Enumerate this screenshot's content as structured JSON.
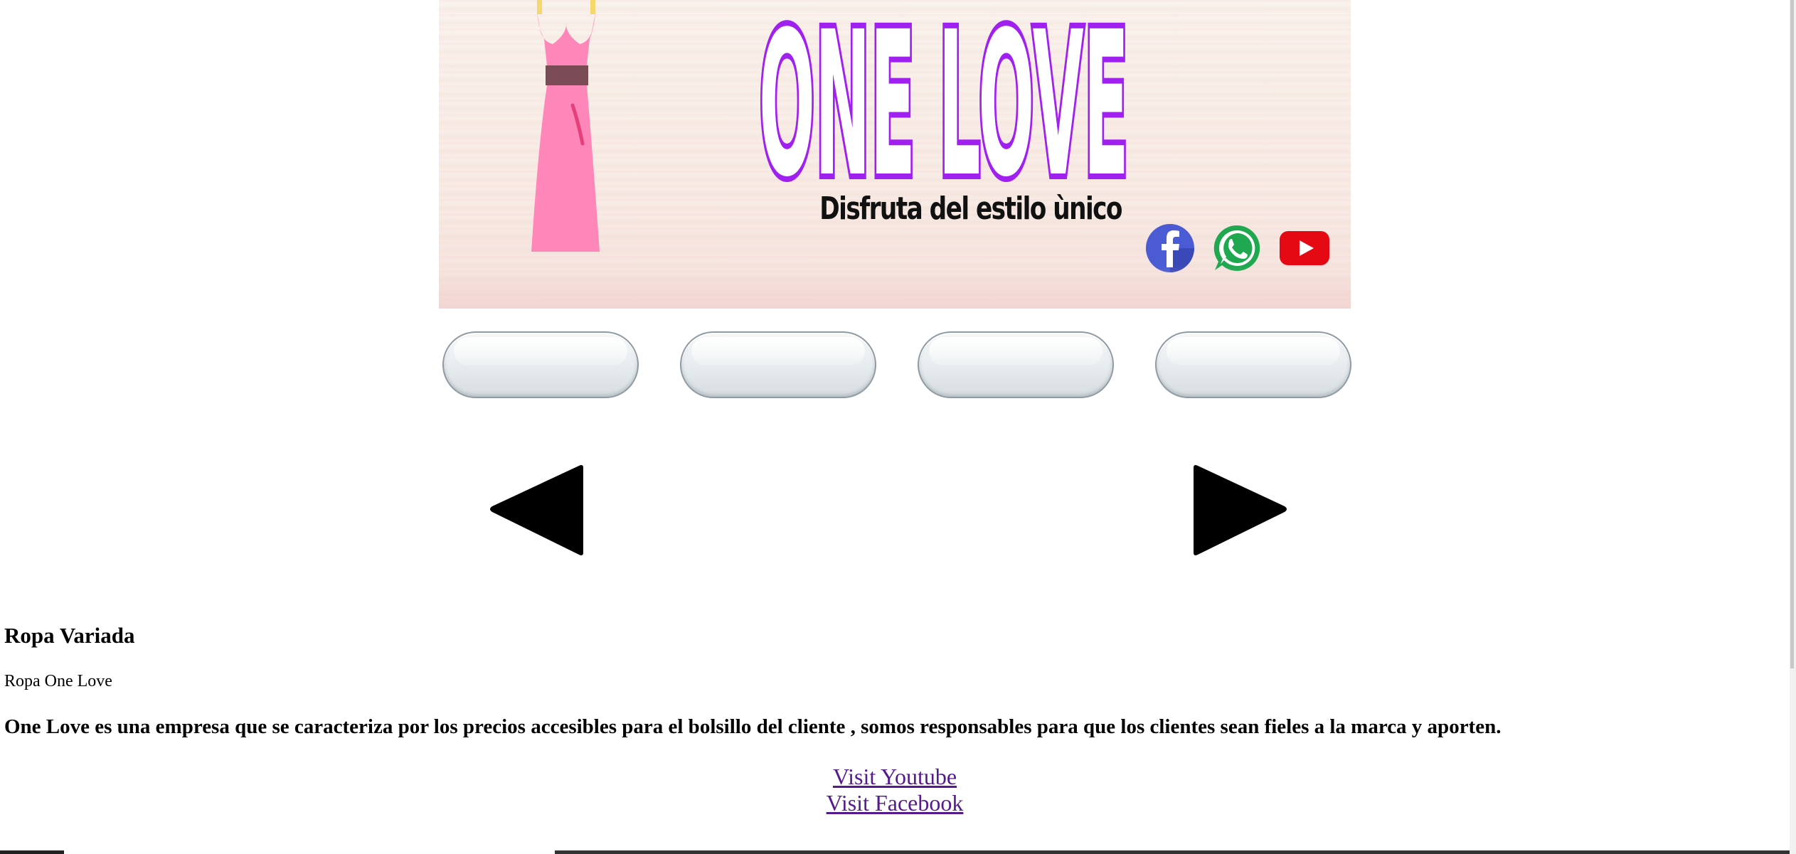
{
  "banner": {
    "logo_text": "ONE LOVE",
    "tagline": "Disfruta del estilo ùnico",
    "social": [
      {
        "icon": "facebook-icon",
        "color": "#4a5bd4"
      },
      {
        "icon": "whatsapp-icon",
        "color": "#1fa84f"
      },
      {
        "icon": "youtube-icon",
        "color": "#e50914"
      }
    ],
    "colors": {
      "logo_fill": "#ffffff",
      "logo_outline": "#a020f0",
      "dress": "#ff86b8",
      "dress_belt": "#7a4a55",
      "strap": "#f5d76e"
    }
  },
  "nav": {
    "buttons": [
      "",
      "",
      "",
      ""
    ]
  },
  "slider": {
    "prev_icon": "triangle-left-icon",
    "next_icon": "triangle-right-icon"
  },
  "content": {
    "heading": "Ropa Variada",
    "subtext": "Ropa One Love",
    "description": "One Love es una empresa que se caracteriza por los precios accesibles para el bolsillo del cliente , somos responsables para que los clientes sean fieles a la marca y aporten."
  },
  "links": {
    "youtube": "Visit Youtube",
    "facebook": "Visit Facebook",
    "color": "#551a8b"
  }
}
